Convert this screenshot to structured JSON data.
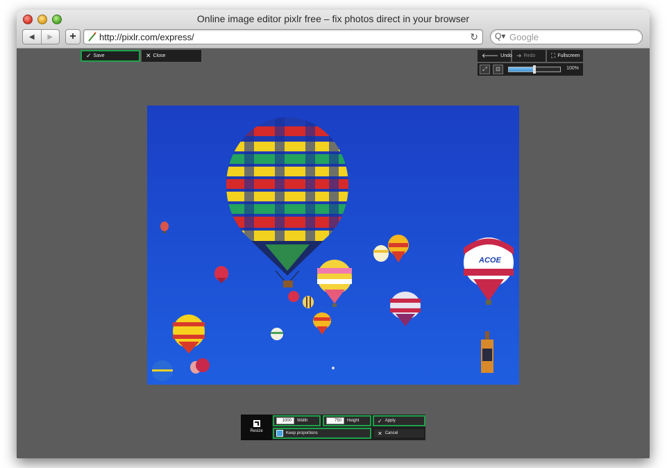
{
  "browser": {
    "window_title": "Online image editor pixlr free – fix photos direct in your browser",
    "back_glyph": "◀",
    "forward_glyph": "▶",
    "add_glyph": "+",
    "url": "http://pixlr.com/express/",
    "reload_glyph": "↻",
    "search_glyph": "Q▾",
    "search_placeholder": "Google"
  },
  "editor": {
    "top_left": {
      "save_label": "Save",
      "close_label": "Close"
    },
    "top_right": {
      "undo_label": "Undo",
      "redo_label": "Redo",
      "fullscreen_label": "Fullscreen",
      "zoom_value": "100%",
      "zoom_fraction": 0.5
    },
    "bottom": {
      "resize_label": "Resize",
      "width_value": "1000",
      "width_label": "Width",
      "height_value": "750",
      "height_label": "Height",
      "apply_label": "Apply",
      "keep_proportions_label": "Keep proportions",
      "cancel_label": "Cancel"
    }
  },
  "icons": {
    "check": "✓",
    "close": "✕",
    "undo": "🡐",
    "redo": "➜",
    "fullscreen": "⛶"
  },
  "colors": {
    "accent_green": "#1fa14a",
    "sky_blue": "#1847c9",
    "toolbar_bg": "#1f1f1f",
    "workspace_bg": "#5c5c5c"
  }
}
